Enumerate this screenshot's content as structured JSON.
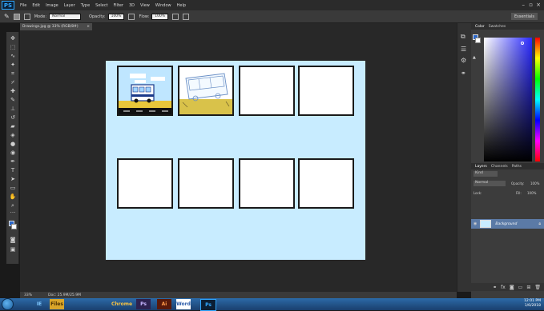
{
  "menubar": {
    "logo": "PS",
    "items": [
      "File",
      "Edit",
      "Image",
      "Layer",
      "Type",
      "Select",
      "Filter",
      "3D",
      "View",
      "Window",
      "Help"
    ]
  },
  "options": {
    "mode_label": "Mode:",
    "mode_value": "Normal",
    "opacity_label": "Opacity:",
    "opacity_value": "100%",
    "flow_label": "Flow:",
    "flow_value": "100%",
    "workspace": "Essentials"
  },
  "document": {
    "tab_title": "Drawings.jpg @ 33% (RGB/8#)",
    "zoom": "33%",
    "doc_info": "Doc: 25.9M/25.9M"
  },
  "color_panel": {
    "tabs": [
      "Color",
      "Swatches"
    ]
  },
  "layers_panel": {
    "tabs": [
      "Layers",
      "Channels",
      "Paths"
    ],
    "kind_label": "Kind",
    "blend_mode": "Normal",
    "opacity_label": "Opacity:",
    "opacity_value": "100%",
    "lock_label": "Lock:",
    "fill_label": "Fill:",
    "fill_value": "100%",
    "layer_name": "Background"
  },
  "taskbar": {
    "apps": [
      "IE",
      "Files",
      "Chrome",
      "Ps",
      "Ai",
      "Word",
      "Ps"
    ],
    "time": "12:01 PM",
    "date": "1/6/2018"
  },
  "colors": {
    "canvas_bg": "#c8ecff",
    "accent": "#31a8ff"
  }
}
